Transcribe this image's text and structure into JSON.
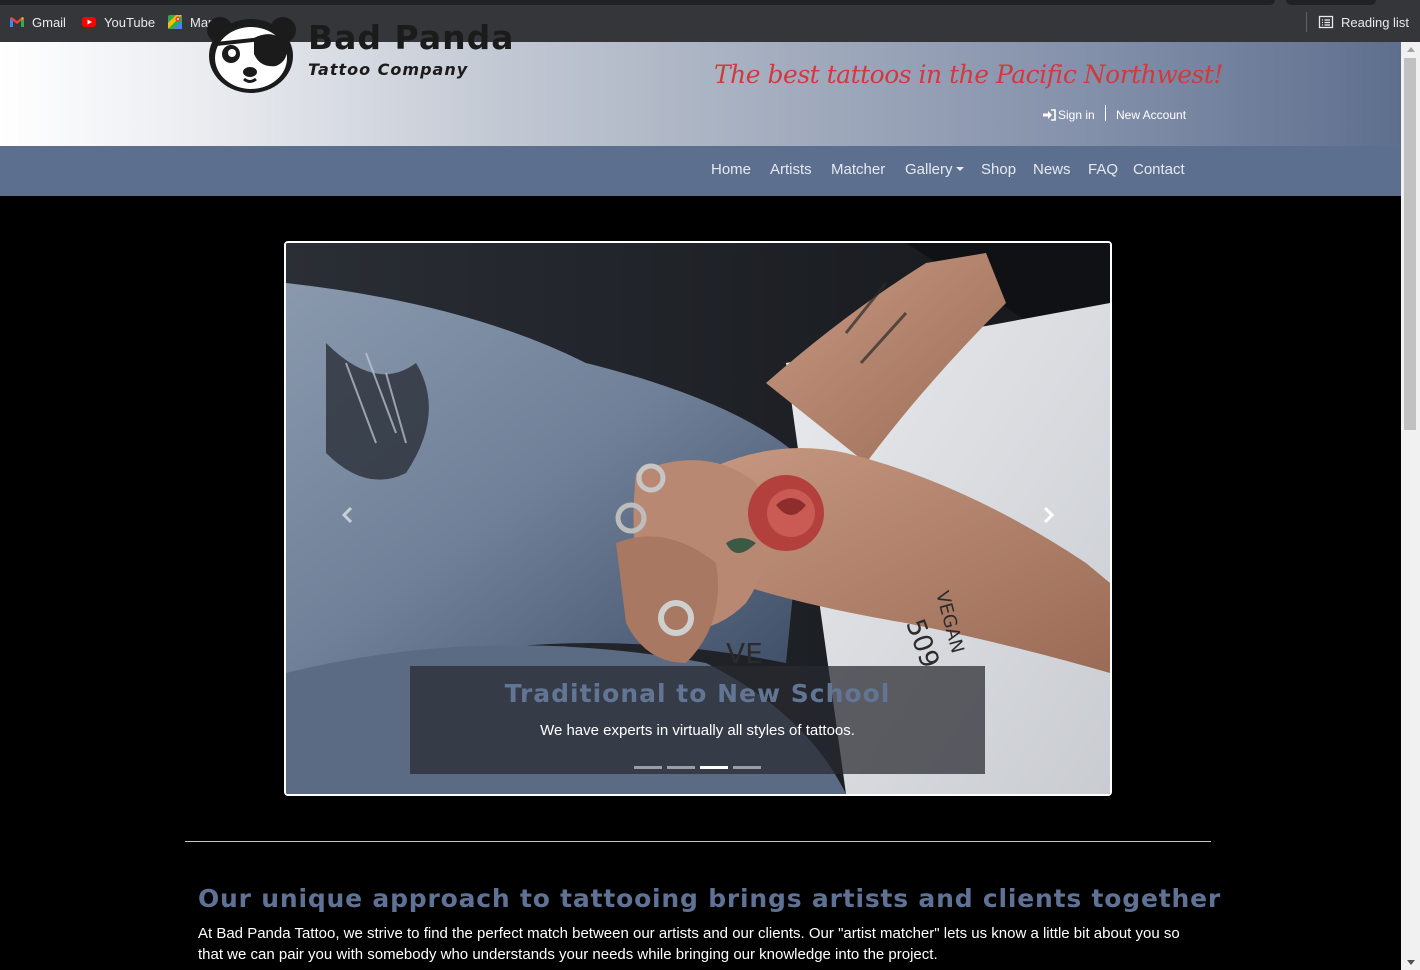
{
  "browser": {
    "bookmarks": [
      {
        "label": "Gmail",
        "icon": "gmail-icon"
      },
      {
        "label": "YouTube",
        "icon": "youtube-icon"
      },
      {
        "label": "Maps",
        "icon": "maps-icon"
      }
    ],
    "reading_list_label": "Reading list"
  },
  "header": {
    "brand": "Bad Panda",
    "brand_sub": "Tattoo Company",
    "tagline": "The best tattoos in the Pacific Northwest!",
    "sign_in_label": "Sign in",
    "new_account_label": "New Account"
  },
  "nav": {
    "items": [
      {
        "label": "Home"
      },
      {
        "label": "Artists"
      },
      {
        "label": "Matcher"
      },
      {
        "label": "Gallery",
        "dropdown": true
      },
      {
        "label": "Shop"
      },
      {
        "label": "News"
      },
      {
        "label": "FAQ"
      },
      {
        "label": "Contact"
      }
    ]
  },
  "carousel": {
    "caption_title": "Traditional to New School",
    "caption_text": "We have experts in virtually all styles of tattoos.",
    "slide_count": 4,
    "active_slide": 3
  },
  "intro": {
    "title": "Our unique approach to tattooing brings artists and clients together",
    "text": "At Bad Panda Tattoo, we strive to find the perfect match between our artists and our clients. Our \"artist matcher\" lets us know a little bit about you so that we can pair you with somebody who understands your needs while bringing our knowledge into the project."
  },
  "colors": {
    "accent": "#5f7296",
    "tagline": "#d1393f",
    "navbar": "#5d6f8f"
  }
}
